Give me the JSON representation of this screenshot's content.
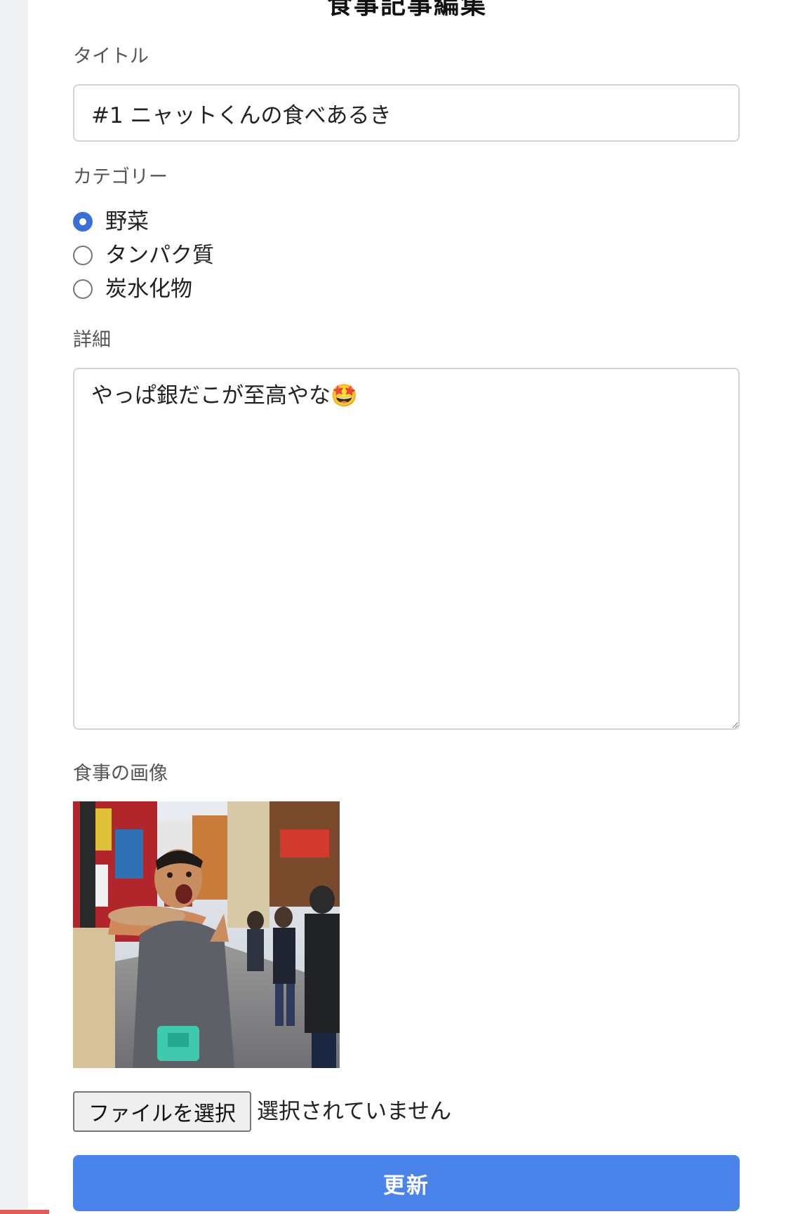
{
  "page": {
    "title": "食事記事編集"
  },
  "form": {
    "title_label": "タイトル",
    "title_value": "#1 ニャットくんの食べあるき",
    "category_label": "カテゴリー",
    "categories": [
      {
        "label": "野菜",
        "checked": true
      },
      {
        "label": "タンパク質",
        "checked": false
      },
      {
        "label": "炭水化物",
        "checked": false
      }
    ],
    "detail_label": "詳細",
    "detail_value": "やっぱ銀だこが至高やな🤩",
    "image_label": "食事の画像",
    "file_button_label": "ファイルを選択",
    "file_status": "選択されていません",
    "submit_label": "更新"
  },
  "colors": {
    "accent": "#3b6fd8",
    "submit_button": "#4a83ea",
    "page_background": "#f0f1f3"
  }
}
